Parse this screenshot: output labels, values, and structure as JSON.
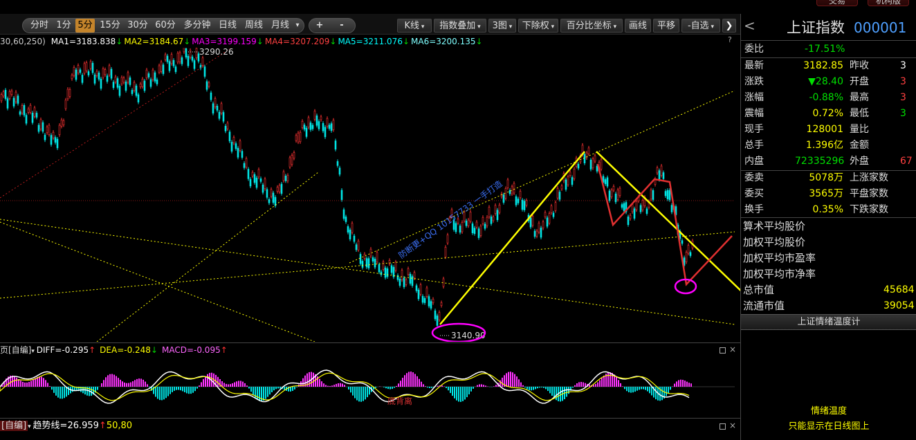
{
  "top_strip": {
    "left_button": "交易",
    "right_button": "机构版"
  },
  "toolbar": {
    "periods": [
      {
        "label": "分时",
        "active": false
      },
      {
        "label": "1分",
        "active": false
      },
      {
        "label": "5分",
        "active": true
      },
      {
        "label": "15分",
        "active": false
      },
      {
        "label": "30分",
        "active": false
      },
      {
        "label": "60分",
        "active": false
      },
      {
        "label": "多分钟",
        "active": false
      },
      {
        "label": "日线",
        "active": false
      },
      {
        "label": "周线",
        "active": false
      },
      {
        "label": "月线",
        "active": false
      }
    ],
    "more_arrow": "▾",
    "plus": "+",
    "minus": "-",
    "kline": "K线",
    "overlay": "指数叠加",
    "three_charts": "3图",
    "exright": "下除权",
    "percent_axis": "百分比坐标",
    "draw": "画线",
    "pan": "平移",
    "self_select": "-自选",
    "collapse": "❯"
  },
  "ma_line": {
    "prefix": "30,60,250)",
    "items": [
      {
        "text": "MA1=3183.838",
        "arrow": "↓",
        "color": "#ffffff",
        "arrow_color": "#00d200"
      },
      {
        "text": "MA2=3184.67",
        "arrow": "↓",
        "color": "#ffff00",
        "arrow_color": "#00d200"
      },
      {
        "text": "MA3=3199.159",
        "arrow": "↓",
        "color": "#ff00ff",
        "arrow_color": "#00d200"
      },
      {
        "text": "MA4=3207.209",
        "arrow": "↓",
        "color": "#ff4040",
        "arrow_color": "#00d200"
      },
      {
        "text": "MA5=3211.076",
        "arrow": "↓",
        "color": "#00ffff",
        "arrow_color": "#00d200"
      },
      {
        "text": "MA6=3200.135",
        "arrow": "↓",
        "color": "#80ffff",
        "arrow_color": "#00d200"
      }
    ],
    "question": "?"
  },
  "price_chart": {
    "high_label": "3290.26",
    "low_label": "3140.90",
    "watermark": "防断更+QQ 10157733 一手打造",
    "annotation": "底背离"
  },
  "macd_line": {
    "title": "页[自编]",
    "items": [
      {
        "text": "DIFF=-0.295",
        "arrow": "↑",
        "color": "#ffffff"
      },
      {
        "text": "DEA=-0.248",
        "arrow": "↓",
        "color": "#ffff00"
      },
      {
        "text": "MACD=-0.095",
        "arrow": "↑",
        "color": "#ff66ff"
      }
    ]
  },
  "trend_line": {
    "title": "[自编]",
    "text": "趋势线=26.959",
    "arrow": "↑",
    "params": "50,80"
  },
  "quote": {
    "back_icon": "<",
    "name": "上证指数",
    "code": "000001",
    "weibi_label": "委比",
    "weibi_value": "-17.51%",
    "rows": [
      {
        "l1": "最新",
        "v1": "3182.85",
        "c1": "#ffff00",
        "l2": "昨收",
        "v2": "3",
        "c2": "#ffffff"
      },
      {
        "l1": "涨跌",
        "v1": "▼28.40",
        "c1": "#00e000",
        "l2": "开盘",
        "v2": "3",
        "c2": "#ff4040"
      },
      {
        "l1": "涨幅",
        "v1": "-0.88%",
        "c1": "#00e000",
        "l2": "最高",
        "v2": "3",
        "c2": "#ff4040"
      },
      {
        "l1": "震幅",
        "v1": "0.72%",
        "c1": "#ffff00",
        "l2": "最低",
        "v2": "3",
        "c2": "#00e000"
      },
      {
        "l1": "现手",
        "v1": "128001",
        "c1": "#ffff00",
        "l2": "量比",
        "v2": "",
        "c2": "#ffffff"
      },
      {
        "l1": "总手",
        "v1": "1.396亿",
        "c1": "#ffff00",
        "l2": "金额",
        "v2": "",
        "c2": "#ffffff"
      },
      {
        "l1": "内盘",
        "v1": "72335296",
        "c1": "#00e000",
        "l2": "外盘",
        "v2": "67",
        "c2": "#ff4040"
      }
    ],
    "rows2": [
      {
        "l1": "委卖",
        "v1": "5078万",
        "l2": "上涨家数"
      },
      {
        "l1": "委买",
        "v1": "3565万",
        "l2": "平盘家数"
      },
      {
        "l1": "换手",
        "v1": "0.35%",
        "l2": "下跌家数"
      }
    ],
    "list": [
      {
        "label": "算术平均股价",
        "value": ""
      },
      {
        "label": "加权平均股价",
        "value": ""
      },
      {
        "label": "加权平均市盈率",
        "value": ""
      },
      {
        "label": "加权平均市净率",
        "value": ""
      },
      {
        "label": "总市值",
        "value": "45684"
      },
      {
        "label": "流通市值",
        "value": "39054"
      }
    ],
    "thermo_title": "上证情绪温度计",
    "thermo_label": "情绪温度",
    "thermo_note": "只能显示在日线图上"
  }
}
